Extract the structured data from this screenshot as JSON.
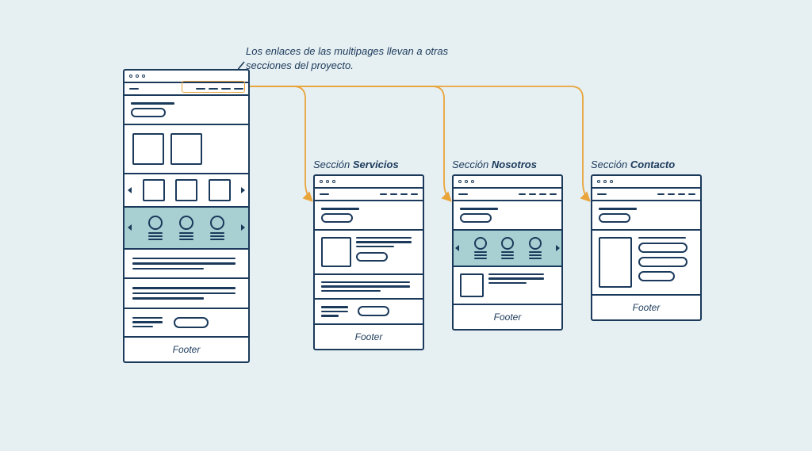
{
  "annotation": "Los enlaces de las multipages llevan a otras secciones del proyecto.",
  "sections": {
    "servicios": {
      "prefix": "Sección ",
      "name": "Servicios"
    },
    "nosotros": {
      "prefix": "Sección ",
      "name": "Nosotros"
    },
    "contacto": {
      "prefix": "Sección ",
      "name": "Contacto"
    }
  },
  "footer_label": "Footer",
  "colors": {
    "stroke": "#1b3a5b",
    "accent": "#e9a43a",
    "teal": "#a8cfd2",
    "paper": "#ffffff",
    "bg": "#e6eff2"
  }
}
